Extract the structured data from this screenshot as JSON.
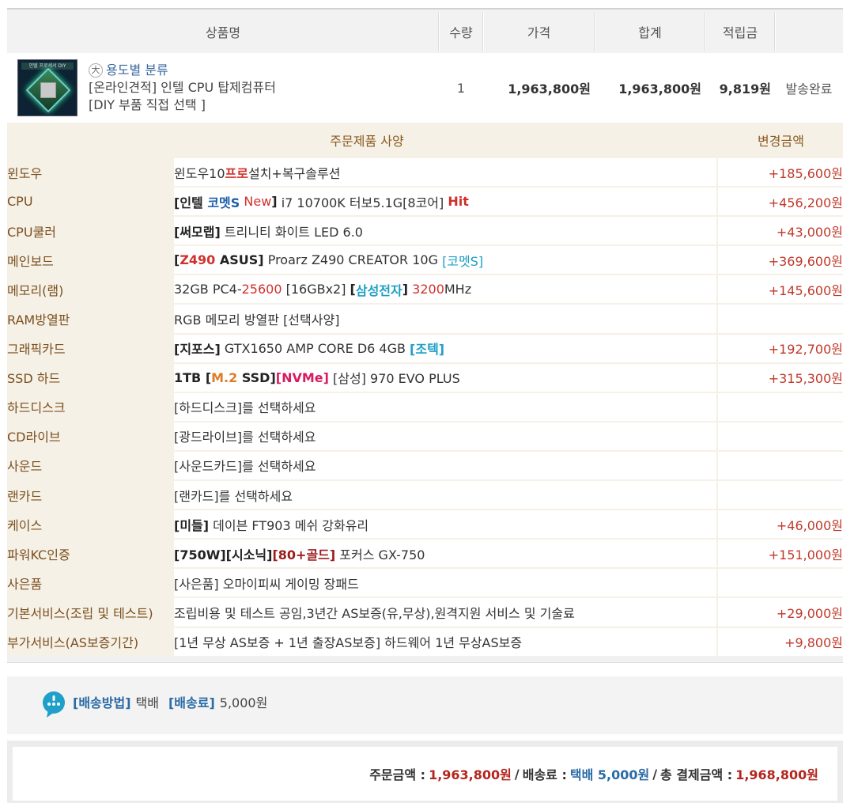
{
  "columns": {
    "product": "상품명",
    "qty": "수량",
    "price": "가격",
    "total": "합계",
    "points": "적립금"
  },
  "product": {
    "thumbnail_caption": "인텔 프로세서 DIY",
    "category": "용도별 분류",
    "name_line1": "[온라인견적] 인텔 CPU 탑제컴퓨터",
    "name_line2": "[DIY 부품 직접 선택 ]",
    "qty": "1",
    "price": "1,963,800원",
    "total": "1,963,800원",
    "points": "9,819원",
    "status": "발송완료"
  },
  "spec_header": {
    "spec": "주문제품 사양",
    "amount": "변경금액"
  },
  "specs": [
    {
      "label": "윈도우",
      "parts": [
        {
          "t": "윈도우10"
        },
        {
          "t": "프로",
          "c": "red",
          "b": true
        },
        {
          "t": "설치+복구솔루션"
        }
      ],
      "amount": "+185,600원"
    },
    {
      "label": "CPU",
      "parts": [
        {
          "t": "[인텔 ",
          "b": true
        },
        {
          "t": "코멧S",
          "c": "blue",
          "b": true
        },
        {
          "t": " "
        },
        {
          "t": "New",
          "c": "red"
        },
        {
          "t": "]",
          "b": true
        },
        {
          "t": " i7 10700K 터보5.1G[8코어] "
        },
        {
          "t": "Hit",
          "c": "red",
          "b": true
        }
      ],
      "amount": "+456,200원"
    },
    {
      "label": "CPU쿨러",
      "parts": [
        {
          "t": "[써모랩]",
          "b": true
        },
        {
          "t": " 트리니티 화이트 LED 6.0"
        }
      ],
      "amount": "+43,000원"
    },
    {
      "label": "메인보드",
      "parts": [
        {
          "t": "[",
          "b": true
        },
        {
          "t": "Z490",
          "c": "red",
          "b": true
        },
        {
          "t": " ASUS]",
          "b": true
        },
        {
          "t": " Proarz Z490 CREATOR 10G "
        },
        {
          "t": "[코멧S]",
          "c": "cyan"
        }
      ],
      "amount": "+369,600원"
    },
    {
      "label": "메모리(램)",
      "parts": [
        {
          "t": "32GB PC4-"
        },
        {
          "t": "25600",
          "c": "red"
        },
        {
          "t": " [16GBx2] "
        },
        {
          "t": "[",
          "b": true
        },
        {
          "t": "삼성전자",
          "c": "cyan",
          "b": true
        },
        {
          "t": "]",
          "b": true
        },
        {
          "t": " "
        },
        {
          "t": "3200",
          "c": "red"
        },
        {
          "t": "MHz"
        }
      ],
      "amount": "+145,600원"
    },
    {
      "label": "RAM방열판",
      "parts": [
        {
          "t": "RGB 메모리 방열판 [선택사양]"
        }
      ],
      "amount": ""
    },
    {
      "label": "그래픽카드",
      "parts": [
        {
          "t": "[지포스]",
          "b": true
        },
        {
          "t": " GTX1650 AMP CORE D6 4GB "
        },
        {
          "t": "[조텍]",
          "c": "cyan",
          "b": true
        }
      ],
      "amount": "+192,700원"
    },
    {
      "label": "SSD 하드",
      "parts": [
        {
          "t": "1TB [",
          "b": true
        },
        {
          "t": "M.2",
          "c": "orange",
          "b": true
        },
        {
          "t": " SSD]",
          "b": true
        },
        {
          "t": "[NVMe]",
          "c": "magenta",
          "b": true
        },
        {
          "t": " [삼성] 970 EVO PLUS"
        }
      ],
      "amount": "+315,300원"
    },
    {
      "label": "하드디스크",
      "parts": [
        {
          "t": "[하드디스크]를 선택하세요"
        }
      ],
      "amount": ""
    },
    {
      "label": "CD라이브",
      "parts": [
        {
          "t": "[광드라이브]를 선택하세요"
        }
      ],
      "amount": ""
    },
    {
      "label": "사운드",
      "parts": [
        {
          "t": "[사운드카드]를 선택하세요"
        }
      ],
      "amount": ""
    },
    {
      "label": "랜카드",
      "parts": [
        {
          "t": "[랜카드]를 선택하세요"
        }
      ],
      "amount": ""
    },
    {
      "label": "케이스",
      "parts": [
        {
          "t": "[미들]",
          "b": true
        },
        {
          "t": " 데이븐 FT903 메쉬 강화유리"
        }
      ],
      "amount": "+46,000원"
    },
    {
      "label": "파워KC인증",
      "parts": [
        {
          "t": "[750W][시소닉]",
          "b": true
        },
        {
          "t": "[80+골드]",
          "c": "darkred",
          "b": true
        },
        {
          "t": " 포커스 GX-750"
        }
      ],
      "amount": "+151,000원"
    },
    {
      "label": "사은품",
      "parts": [
        {
          "t": "[사은품] 오마이피씨 게이밍 장패드"
        }
      ],
      "amount": ""
    },
    {
      "label": "기본서비스(조립 및 테스트)",
      "parts": [
        {
          "t": "조립비용 및 테스트 공임,3년간 AS보증(유,무상),원격지원 서비스 및 기술료"
        }
      ],
      "amount": "+29,000원"
    },
    {
      "label": "부가서비스(AS보증기간)",
      "parts": [
        {
          "t": "[1년 무상 AS보증 + 1년 출장AS보증] 하드웨어 1년 무상AS보증"
        }
      ],
      "amount": "+9,800원"
    }
  ],
  "shipping": {
    "method_label": "[배송방법]",
    "method": "택배",
    "fee_label": "[배송료]",
    "fee": "5,000원"
  },
  "totals": {
    "order_label": "주문금액 :",
    "order_value": "1,963,800원",
    "sep1": "/",
    "ship_label": "배송료 :",
    "ship_value": "택배 5,000원",
    "sep2": "/",
    "grand_label": "총 결제금액 :",
    "grand_value": "1,968,800원"
  },
  "colors": {
    "red": "#d0312d",
    "blue": "#1f5fa8",
    "cyan": "#1f9fc4",
    "orange": "#e07b26",
    "magenta": "#d81b60",
    "darkred": "#9b1c1c",
    "label": "#7a4f1f",
    "amount": "#c0392b"
  }
}
